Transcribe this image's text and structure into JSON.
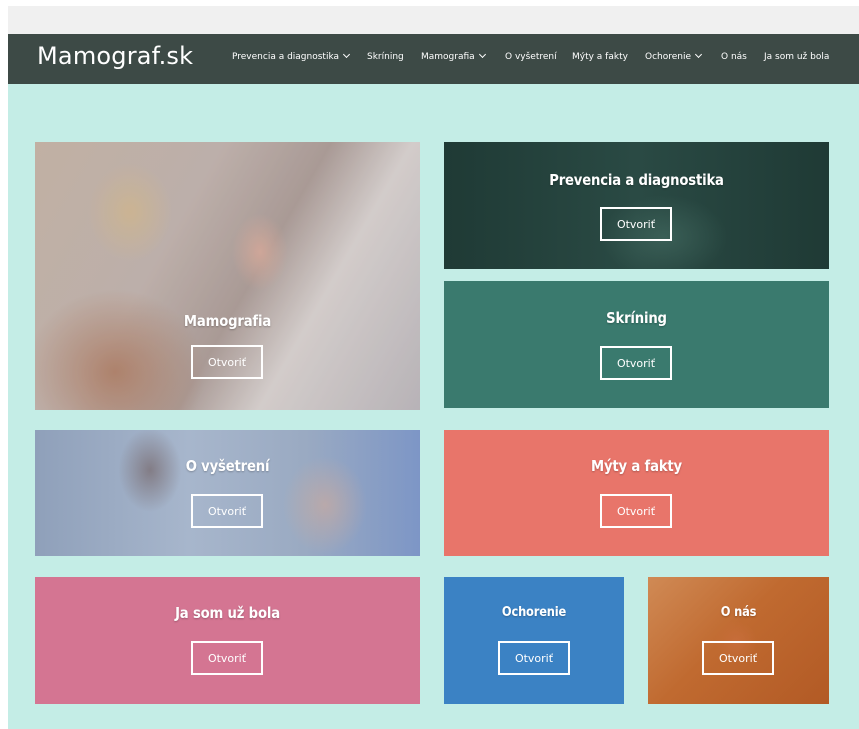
{
  "site": {
    "logo": "Mamograf.sk"
  },
  "nav": {
    "items": [
      {
        "label": "Prevencia a diagnostika",
        "dropdown": true
      },
      {
        "label": "Skríning",
        "dropdown": false
      },
      {
        "label": "Mamografia",
        "dropdown": true
      },
      {
        "label": "O vyšetrení",
        "dropdown": false
      },
      {
        "label": "Mýty a fakty",
        "dropdown": false
      },
      {
        "label": "Ochorenie",
        "dropdown": true
      },
      {
        "label": "O nás",
        "dropdown": false
      },
      {
        "label": "Ja som už bola",
        "dropdown": false
      }
    ]
  },
  "tiles": [
    {
      "title": "Mamografia",
      "button": "Otvoriť",
      "background": "photo"
    },
    {
      "title": "Prevencia a diagnostika",
      "button": "Otvoriť",
      "background": "photo"
    },
    {
      "title": "Skríning",
      "button": "Otvoriť",
      "background": "#3a7a6e"
    },
    {
      "title": "O vyšetrení",
      "button": "Otvoriť",
      "background": "photo"
    },
    {
      "title": "Mýty a fakty",
      "button": "Otvoriť",
      "background": "#e8756a"
    },
    {
      "title": "Ja som už bola",
      "button": "Otvoriť",
      "background": "#d47592"
    },
    {
      "title": "Ochorenie",
      "button": "Otvoriť",
      "background": "#3b82c4"
    },
    {
      "title": "O nás",
      "button": "Otvoriť",
      "background": "photo"
    }
  ],
  "colors": {
    "navbar": "#3d4a46",
    "page_background": "#c4ede6",
    "skrining": "#3a7a6e",
    "myty": "#e8756a",
    "ja_som": "#d47592",
    "ochorenie": "#3b82c4"
  },
  "icons": {
    "dropdown": "chevron-down-icon"
  }
}
